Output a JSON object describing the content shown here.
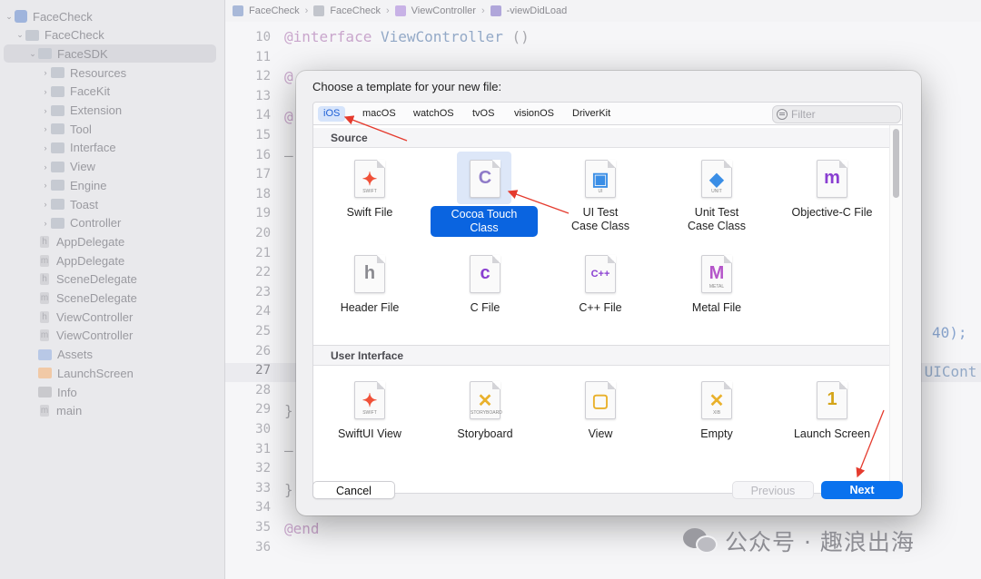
{
  "breadcrumb": [
    "FaceCheck",
    "FaceCheck",
    "ViewController",
    "-viewDidLoad"
  ],
  "sidebar": {
    "items": [
      {
        "label": "FaceCheck",
        "kind": "project",
        "depth": 0,
        "disclosure": "⌄"
      },
      {
        "label": "FaceCheck",
        "kind": "folder",
        "depth": 1,
        "disclosure": "⌄"
      },
      {
        "label": "FaceSDK",
        "kind": "folder",
        "depth": 2,
        "disclosure": "⌄",
        "selected": true
      },
      {
        "label": "Resources",
        "kind": "folder",
        "depth": 3,
        "disclosure": "›"
      },
      {
        "label": "FaceKit",
        "kind": "folder",
        "depth": 3,
        "disclosure": "›"
      },
      {
        "label": "Extension",
        "kind": "folder",
        "depth": 3,
        "disclosure": "›"
      },
      {
        "label": "Tool",
        "kind": "folder",
        "depth": 3,
        "disclosure": "›"
      },
      {
        "label": "Interface",
        "kind": "folder",
        "depth": 3,
        "disclosure": "›"
      },
      {
        "label": "View",
        "kind": "folder",
        "depth": 3,
        "disclosure": "›"
      },
      {
        "label": "Engine",
        "kind": "folder",
        "depth": 3,
        "disclosure": "›"
      },
      {
        "label": "Toast",
        "kind": "folder",
        "depth": 3,
        "disclosure": "›"
      },
      {
        "label": "Controller",
        "kind": "folder",
        "depth": 3,
        "disclosure": "›"
      },
      {
        "label": "AppDelegate",
        "kind": "file",
        "glyph": "h",
        "depth": 2
      },
      {
        "label": "AppDelegate",
        "kind": "file",
        "glyph": "m",
        "depth": 2
      },
      {
        "label": "SceneDelegate",
        "kind": "file",
        "glyph": "h",
        "depth": 2
      },
      {
        "label": "SceneDelegate",
        "kind": "file",
        "glyph": "m",
        "depth": 2
      },
      {
        "label": "ViewController",
        "kind": "file",
        "glyph": "h",
        "depth": 2
      },
      {
        "label": "ViewController",
        "kind": "file",
        "glyph": "m",
        "depth": 2
      },
      {
        "label": "Assets",
        "kind": "asset",
        "depth": 2
      },
      {
        "label": "LaunchScreen",
        "kind": "launch",
        "depth": 2
      },
      {
        "label": "Info",
        "kind": "plist",
        "depth": 2
      },
      {
        "label": "main",
        "kind": "file",
        "glyph": "m",
        "depth": 2
      }
    ]
  },
  "editor": {
    "line_numbers": [
      "10",
      "11",
      "12",
      "13",
      "14",
      "15",
      "16",
      "17",
      "18",
      "19",
      "20",
      "21",
      "22",
      "23",
      "24",
      "25",
      "26",
      "27",
      "28",
      "29",
      "30",
      "31",
      "32",
      "33",
      "34",
      "35",
      "36"
    ],
    "current_line": "27",
    "fragments": {
      "l10_kw": "@interface",
      "l10_type": " ViewController",
      "l10_rest": " ()",
      "l12": "@",
      "l14": "@",
      "l16": "–",
      "l25": "40);",
      "l27": ":UICont",
      "l29": "}",
      "l31": "–",
      "l33": "}",
      "l35": "@end"
    }
  },
  "dialog": {
    "title": "Choose a template for your new file:",
    "tabs": [
      "iOS",
      "macOS",
      "watchOS",
      "tvOS",
      "visionOS",
      "DriverKit"
    ],
    "active_tab": "iOS",
    "filter_placeholder": "Filter",
    "sections": [
      {
        "header": "Source",
        "items": [
          {
            "label": "Swift File",
            "icon": "swift-icon",
            "glyph": "✦",
            "sub": "SWIFT",
            "color": "#f05138"
          },
          {
            "label": "Cocoa Touch Class",
            "icon": "cocoa-touch-class-icon",
            "glyph": "C",
            "sub": "",
            "color": "#8f7bc8",
            "selected": true
          },
          {
            "label": "UI Test Case Class",
            "icon": "ui-test-icon",
            "glyph": "▣",
            "sub": "UI",
            "color": "#3a8ee6"
          },
          {
            "label": "Unit Test Case Class",
            "icon": "unit-test-icon",
            "glyph": "◆",
            "sub": "UNIT",
            "color": "#3a8ee6"
          },
          {
            "label": "Objective-C File",
            "icon": "objective-c-icon",
            "glyph": "m",
            "sub": "",
            "color": "#8a3fd1"
          },
          {
            "label": "Header File",
            "icon": "header-file-icon",
            "glyph": "h",
            "sub": "",
            "color": "#8a8a90"
          },
          {
            "label": "C File",
            "icon": "c-file-icon",
            "glyph": "c",
            "sub": "",
            "color": "#8a3fd1"
          },
          {
            "label": "C++ File",
            "icon": "cpp-file-icon",
            "glyph": "C++",
            "sub": "",
            "color": "#8a3fd1"
          },
          {
            "label": "Metal File",
            "icon": "metal-file-icon",
            "glyph": "M",
            "sub": "METAL",
            "color": "#b455c9"
          }
        ]
      },
      {
        "header": "User Interface",
        "items": [
          {
            "label": "SwiftUI View",
            "icon": "swiftui-view-icon",
            "glyph": "✦",
            "sub": "SWIFT",
            "color": "#f05138"
          },
          {
            "label": "Storyboard",
            "icon": "storyboard-icon",
            "glyph": "✕",
            "sub": "STORYBOARD",
            "color": "#e9b12b"
          },
          {
            "label": "View",
            "icon": "view-icon",
            "glyph": "▢",
            "sub": "",
            "color": "#e9b12b"
          },
          {
            "label": "Empty",
            "icon": "empty-xib-icon",
            "glyph": "✕",
            "sub": "XIB",
            "color": "#e9b12b"
          },
          {
            "label": "Launch Screen",
            "icon": "launch-screen-icon",
            "glyph": "1",
            "sub": "",
            "color": "#d4a418"
          }
        ]
      }
    ],
    "buttons": {
      "cancel": "Cancel",
      "previous": "Previous",
      "next": "Next"
    }
  },
  "watermark": {
    "text": "公众号 · 趣浪出海"
  },
  "colors": {
    "accent": "#0a72ee",
    "annotation_arrow": "#e53b2e"
  }
}
